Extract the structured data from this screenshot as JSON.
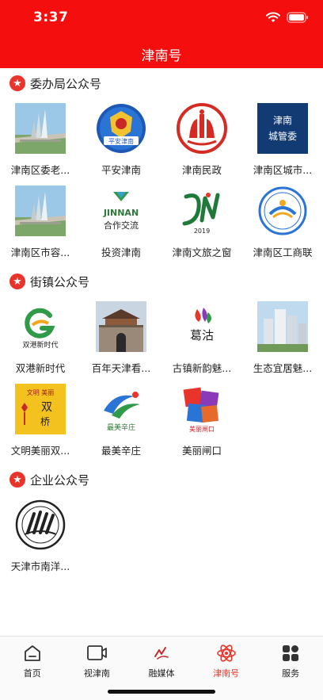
{
  "status": {
    "time": "3:37",
    "wifi_icon": "wifi-icon",
    "battery_icon": "battery-icon"
  },
  "header": {
    "title": "津南号"
  },
  "sections": [
    {
      "title": "委办局公众号",
      "items": [
        {
          "label": "津南区委老...",
          "icon": "monument-thumb"
        },
        {
          "label": "平安津南",
          "icon": "police-badge-thumb",
          "logo_text": "平安津南"
        },
        {
          "label": "津南民政",
          "icon": "civil-affairs-logo-thumb"
        },
        {
          "label": "津南区城市...",
          "icon": "city-management-logo-thumb",
          "logo_text": "津南\n城管委"
        },
        {
          "label": "津南区市容...",
          "icon": "monument-thumb"
        },
        {
          "label": "投资津南",
          "icon": "jinnan-cooperation-logo-thumb",
          "logo_text": "JINNAN\n合作交流"
        },
        {
          "label": "津南文旅之窗",
          "icon": "jn-2019-logo-thumb",
          "logo_text": "2019"
        },
        {
          "label": "津南区工商联",
          "icon": "federation-logo-thumb"
        }
      ]
    },
    {
      "title": "街镇公众号",
      "items": [
        {
          "label": "双港新时代",
          "icon": "shuanggang-logo-thumb",
          "logo_text": "双港新时代"
        },
        {
          "label": "百年天津看...",
          "icon": "city-gate-thumb"
        },
        {
          "label": "古镇新韵魅...",
          "icon": "gezhen-logo-thumb",
          "logo_text": "葛沽"
        },
        {
          "label": "生态宜居魅...",
          "icon": "buildings-thumb"
        },
        {
          "label": "文明美丽双...",
          "icon": "wenming-logo-thumb",
          "logo_text": "文明 美丽\n双\n桥"
        },
        {
          "label": "最美辛庄",
          "icon": "xinzhuang-logo-thumb",
          "logo_text": "最美辛庄"
        },
        {
          "label": "美丽闸口",
          "icon": "zhakou-logo-thumb",
          "logo_text": "美丽闸口"
        }
      ]
    },
    {
      "title": "企业公众号",
      "items": [
        {
          "label": "天津市南洋...",
          "icon": "nanyang-school-logo-thumb"
        }
      ]
    }
  ],
  "tabbar": {
    "active_color": "#e8342a",
    "tabs": [
      {
        "label": "首页",
        "icon": "home-icon"
      },
      {
        "label": "视津南",
        "icon": "video-icon"
      },
      {
        "label": "融媒体",
        "icon": "media-icon"
      },
      {
        "label": "津南号",
        "icon": "atom-icon",
        "active": true
      },
      {
        "label": "服务",
        "icon": "grid-icon"
      }
    ]
  }
}
